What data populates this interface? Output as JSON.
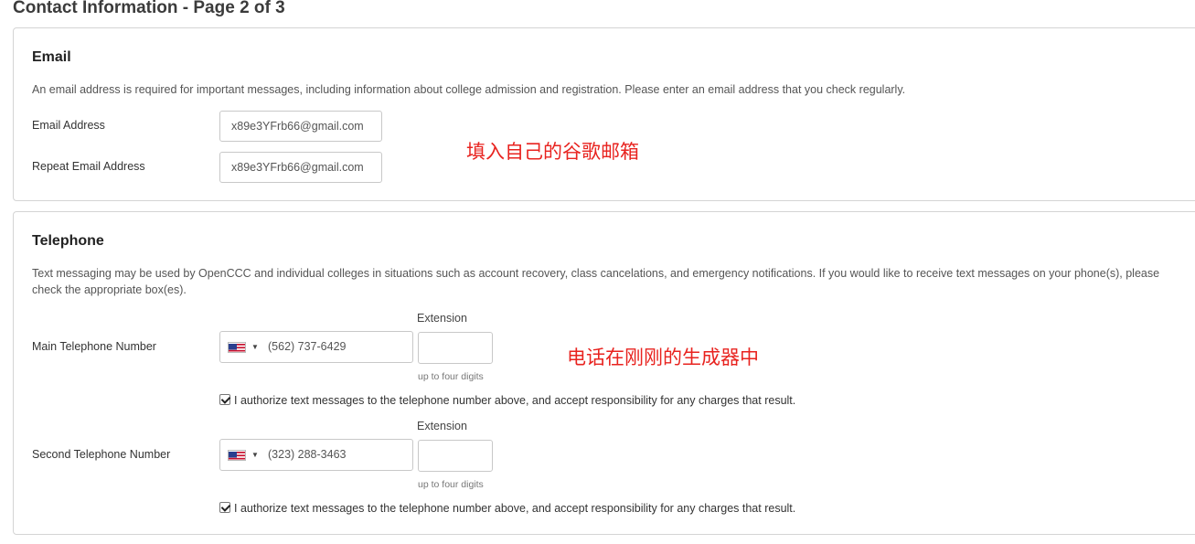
{
  "page": {
    "title": "Contact Information - Page 2 of 3"
  },
  "email_section": {
    "heading": "Email",
    "description": "An email address is required for important messages, including information about college admission and registration. Please enter an email address that you check regularly.",
    "email_label": "Email Address",
    "email_value": "x89e3YFrb66@gmail.com",
    "repeat_label": "Repeat Email Address",
    "repeat_value": "x89e3YFrb66@gmail.com",
    "annotation": "填入自己的谷歌邮箱"
  },
  "telephone_section": {
    "heading": "Telephone",
    "description": "Text messaging may be used by OpenCCC and individual colleges in situations such as account recovery, class cancelations, and emergency notifications. If you would like to receive text messages on your phone(s), please check the appropriate box(es).",
    "annotation": "电话在刚刚的生成器中",
    "main": {
      "label": "Main Telephone Number",
      "country_flag": "us-flag-icon",
      "number": "(562) 737-6429",
      "extension_label": "Extension",
      "extension_value": "",
      "extension_help": "up to four digits",
      "sms_checked": true,
      "authorize_text": "I authorize text messages to the telephone number above, and accept responsibility for any charges that result."
    },
    "second": {
      "label": "Second Telephone Number",
      "country_flag": "us-flag-icon",
      "number": "(323) 288-3463",
      "extension_label": "Extension",
      "extension_value": "",
      "extension_help": "up to four digits",
      "sms_checked": true,
      "authorize_text": "I authorize text messages to the telephone number above, and accept responsibility for any charges that result."
    }
  },
  "colors": {
    "annotation": "#e8231f",
    "border": "#d4d4d4"
  }
}
